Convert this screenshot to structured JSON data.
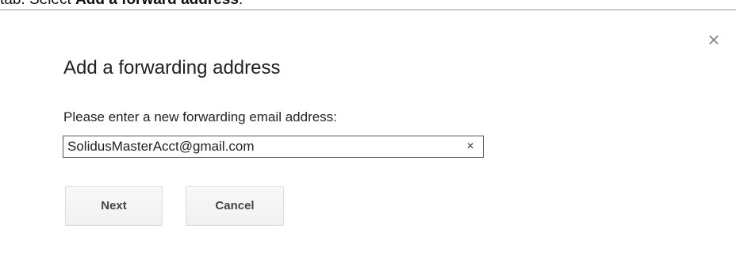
{
  "instruction": {
    "prefix": "tab.  Select ",
    "bold": "Add a forward address",
    "suffix": "."
  },
  "dialog": {
    "close_icon": "×",
    "title": "Add a forwarding address",
    "prompt": "Please enter a new forwarding email address:",
    "email_value": "SolidusMasterAcct@gmail.com",
    "clear_icon": "×",
    "next_label": "Next",
    "cancel_label": "Cancel"
  }
}
